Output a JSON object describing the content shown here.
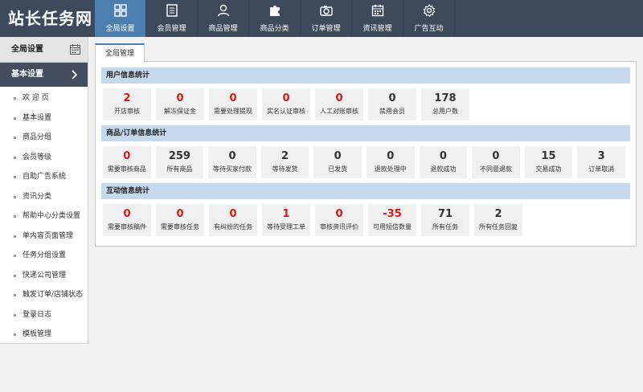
{
  "app": {
    "logo": "站长任务网"
  },
  "topnav": [
    {
      "label": "全局设置",
      "icon": "grid-icon",
      "active": true
    },
    {
      "label": "会员管理",
      "icon": "document-icon",
      "active": false
    },
    {
      "label": "商品管理",
      "icon": "user-icon",
      "active": false
    },
    {
      "label": "商品分类",
      "icon": "puzzle-icon",
      "active": false
    },
    {
      "label": "订单管理",
      "icon": "camera-icon",
      "active": false
    },
    {
      "label": "资讯管理",
      "icon": "calendar-icon",
      "active": false
    },
    {
      "label": "广告互动",
      "icon": "gear-icon",
      "active": false
    }
  ],
  "sidebar": {
    "header": "全局设置",
    "group": "基本设置",
    "items": [
      "欢 迎 页",
      "基本设置",
      "商品分组",
      "会员等级",
      "自助广告系统",
      "资讯分类",
      "帮助中心分类设置",
      "单内容页面管理",
      "任务分组设置",
      "快递公司管理",
      "触发订单/店铺状态",
      "登录日志",
      "模板管理"
    ]
  },
  "main": {
    "tab": "全局管理",
    "sections": [
      {
        "title": "用户信息统计",
        "cards": [
          {
            "value": "2",
            "label": "开店审核",
            "value_color": "red",
            "label_color": "dark"
          },
          {
            "value": "0",
            "label": "解冻保证金",
            "value_color": "red",
            "label_color": "dark"
          },
          {
            "value": "0",
            "label": "需要处理提现",
            "value_color": "red",
            "label_color": "dark"
          },
          {
            "value": "0",
            "label": "实名认证审核",
            "value_color": "red",
            "label_color": "dark"
          },
          {
            "value": "0",
            "label": "人工对账审核",
            "value_color": "red",
            "label_color": "dark"
          },
          {
            "value": "0",
            "label": "禁用会员",
            "value_color": "dark",
            "label_color": "dark"
          },
          {
            "value": "178",
            "label": "总用户数",
            "value_color": "dark",
            "label_color": "dark"
          }
        ]
      },
      {
        "title": "商品/订单信息统计",
        "cards": [
          {
            "value": "0",
            "label": "需要审核商品",
            "value_color": "red",
            "label_color": "dark"
          },
          {
            "value": "259",
            "label": "所有商品",
            "value_color": "dark",
            "label_color": "dark"
          },
          {
            "value": "0",
            "label": "等待买家付款",
            "value_color": "dark",
            "label_color": "gray"
          },
          {
            "value": "2",
            "label": "等待发货",
            "value_color": "dark",
            "label_color": "red"
          },
          {
            "value": "0",
            "label": "已发货",
            "value_color": "dark",
            "label_color": "blue"
          },
          {
            "value": "0",
            "label": "退款处理中",
            "value_color": "dark",
            "label_color": "orange"
          },
          {
            "value": "0",
            "label": "退款成功",
            "value_color": "dark",
            "label_color": "gray"
          },
          {
            "value": "0",
            "label": "不同意退款",
            "value_color": "dark",
            "label_color": "red"
          },
          {
            "value": "15",
            "label": "交易成功",
            "value_color": "dark",
            "label_color": "green"
          },
          {
            "value": "3",
            "label": "订单取消",
            "value_color": "dark",
            "label_color": "gray"
          }
        ]
      },
      {
        "title": "互动信息统计",
        "cards": [
          {
            "value": "0",
            "label": "需要审核稿件",
            "value_color": "red",
            "label_color": "dark"
          },
          {
            "value": "0",
            "label": "需要审核任务",
            "value_color": "red",
            "label_color": "dark"
          },
          {
            "value": "0",
            "label": "有纠纷的任务",
            "value_color": "red",
            "label_color": "dark"
          },
          {
            "value": "1",
            "label": "等待受理工单",
            "value_color": "red",
            "label_color": "dark"
          },
          {
            "value": "0",
            "label": "审核资讯评价",
            "value_color": "red",
            "label_color": "dark"
          },
          {
            "value": "-35",
            "label": "可用短信数量",
            "value_color": "red",
            "label_color": "dark"
          },
          {
            "value": "71",
            "label": "所有任务",
            "value_color": "dark",
            "label_color": "dark"
          },
          {
            "value": "2",
            "label": "所有任务回复",
            "value_color": "dark",
            "label_color": "dark"
          }
        ]
      }
    ]
  },
  "colors": {
    "topbar": "#3c4a5c",
    "nav_active": "#4a7fb0",
    "section_bar": "#c6d9ec",
    "sidebar_group": "#434f5f"
  }
}
